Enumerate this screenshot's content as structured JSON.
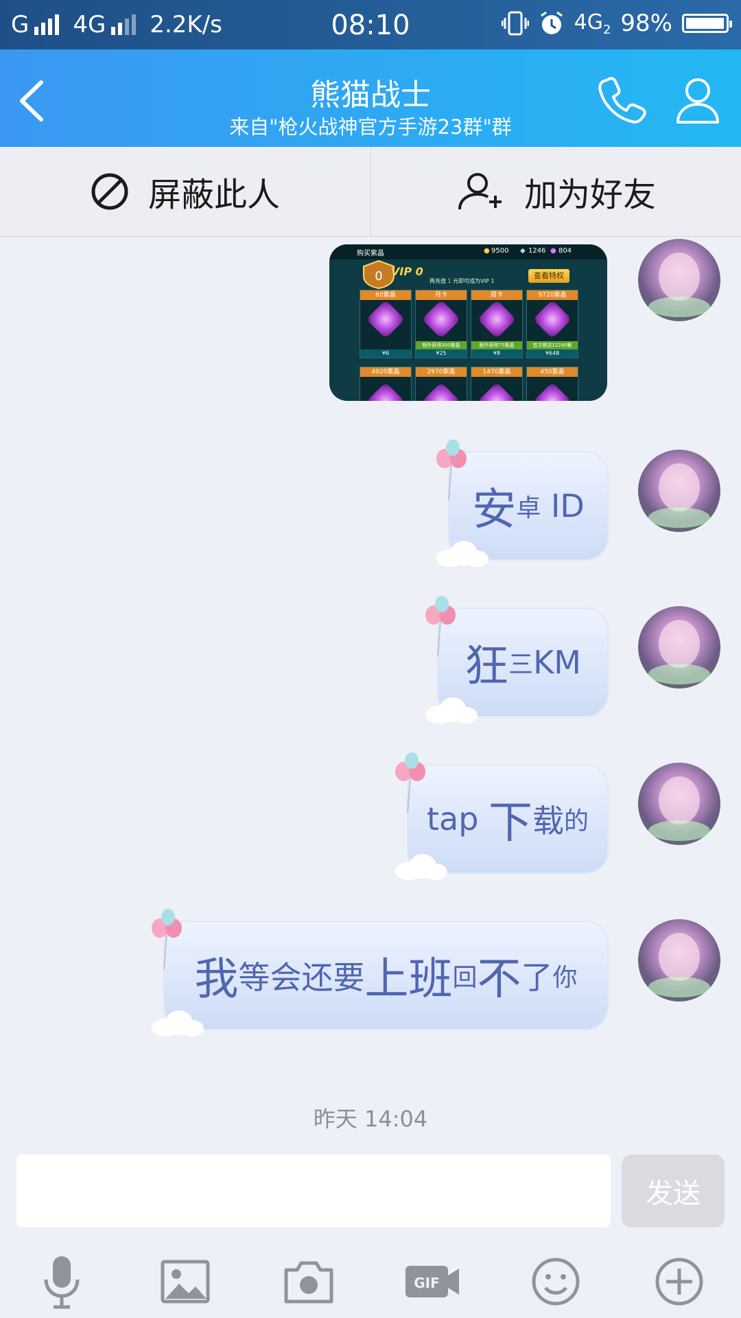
{
  "status_bar": {
    "carrier_1": "G",
    "network_1": "4G",
    "speed": "2.2K/s",
    "time": "08:10",
    "network_2": "4G",
    "sim_index": "2",
    "battery_percent": "98%",
    "battery_level": 0.98
  },
  "header": {
    "title": "熊猫战士",
    "subtitle": "来自\"枪火战神官方手游23群\"群"
  },
  "actions": {
    "block_label": "屏蔽此人",
    "add_friend_label": "加为好友"
  },
  "game_image": {
    "title": "购买紫晶",
    "coins": "9500",
    "diamonds": "1246",
    "gems": "804",
    "vip_badge": "VIP 0",
    "vip_level": "0",
    "recharge_label": "再充值",
    "recharge_value": "1",
    "vip_hint": "元即可成为VIP 1",
    "privilege_button": "查看特权",
    "cards": [
      {
        "name": "60紫晶",
        "price": "¥6",
        "extra": ""
      },
      {
        "name": "月卡",
        "price": "¥25",
        "extra": "额外获得300紫晶"
      },
      {
        "name": "周卡",
        "price": "¥8",
        "extra": "额外获得75紫晶"
      },
      {
        "name": "9720紫晶",
        "price": "¥648",
        "extra": "首次赠送12240紫"
      }
    ],
    "cards_row2": [
      "4920紫晶",
      "2970紫晶",
      "1470紫晶",
      "450紫晶"
    ]
  },
  "messages": [
    {
      "segments": [
        {
          "t": "安",
          "s": "big"
        },
        {
          "t": "卓",
          "s": "sm"
        },
        {
          "t": " ID",
          "s": "md"
        }
      ]
    },
    {
      "segments": [
        {
          "t": "狂",
          "s": "big"
        },
        {
          "t": "三",
          "s": "sm"
        },
        {
          "t": "KM",
          "s": "md"
        }
      ]
    },
    {
      "segments": [
        {
          "t": "tap ",
          "s": "md"
        },
        {
          "t": "下",
          "s": "big"
        },
        {
          "t": "载",
          "s": "md"
        },
        {
          "t": "的",
          "s": "sm"
        }
      ]
    },
    {
      "segments": [
        {
          "t": "我",
          "s": "big"
        },
        {
          "t": "等会还要",
          "s": "md"
        },
        {
          "t": "上班",
          "s": "big"
        },
        {
          "t": "回",
          "s": "sm"
        },
        {
          "t": "不",
          "s": "big"
        },
        {
          "t": "了",
          "s": "md"
        },
        {
          "t": "你",
          "s": "sm"
        }
      ]
    }
  ],
  "timestamp": "昨天 14:04",
  "composer": {
    "input_value": "",
    "send_label": "发送"
  },
  "toolbar": {
    "icons": [
      "microphone-icon",
      "image-icon",
      "camera-icon",
      "gif-icon",
      "emoji-icon",
      "plus-icon"
    ],
    "gif_label": "GIF"
  },
  "colors": {
    "header_start": "#3a98f2",
    "header_end": "#23b8f3",
    "status_bar": "#1f4f86",
    "bubble_text": "#5166b0",
    "background": "#eef0f7"
  }
}
